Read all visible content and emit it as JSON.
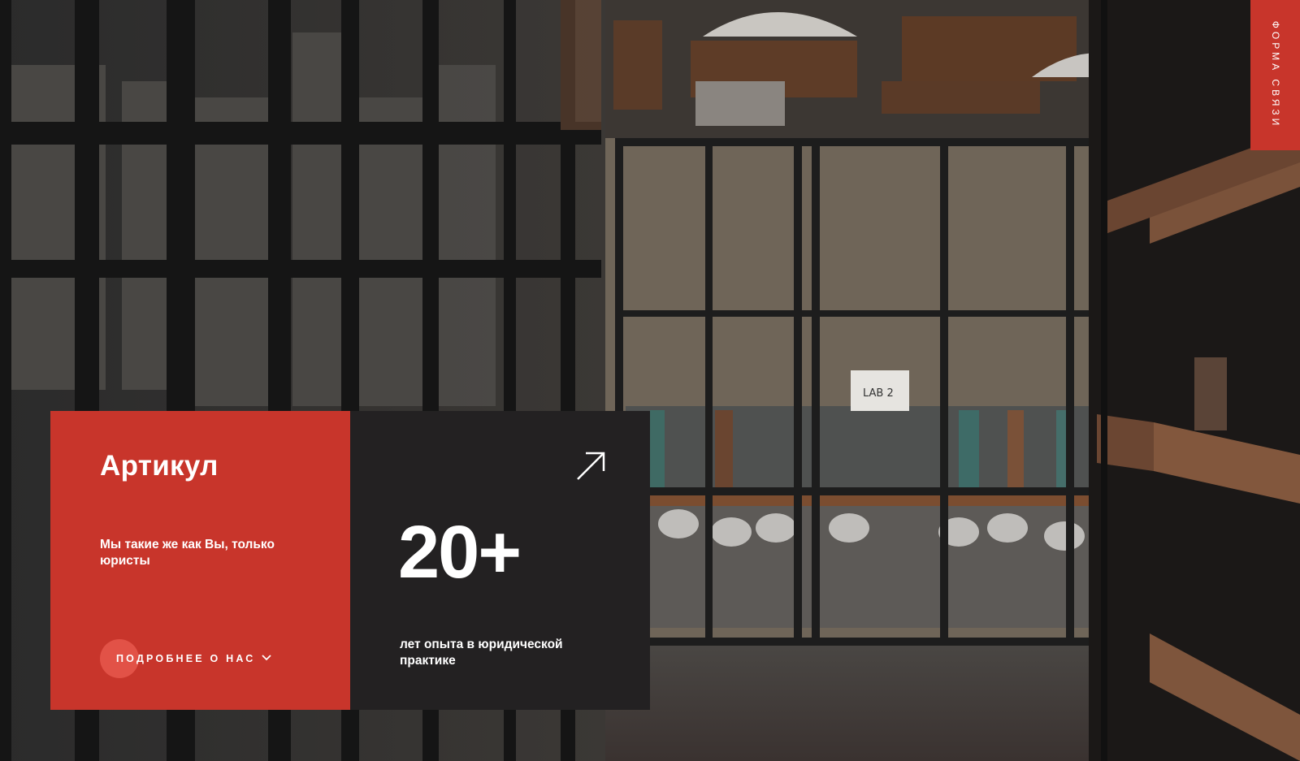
{
  "brand": {
    "name": "Артикул",
    "tagline": "Мы  такие же как Вы, только юристы",
    "more_button": "ПОДРОБНЕЕ О НАС",
    "more_icon": "chevron-down-icon"
  },
  "stat": {
    "value": "20+",
    "caption": "лет опыта в юридической практике",
    "link_icon": "arrow-up-right-icon"
  },
  "side_tab": {
    "label": "ФОРМА СВЯЗИ"
  },
  "background": {
    "sign_text": "LAB 2"
  },
  "colors": {
    "accent": "#c8352b",
    "accent_light": "#e25247",
    "dark_panel": "#232122",
    "text": "#ffffff"
  }
}
